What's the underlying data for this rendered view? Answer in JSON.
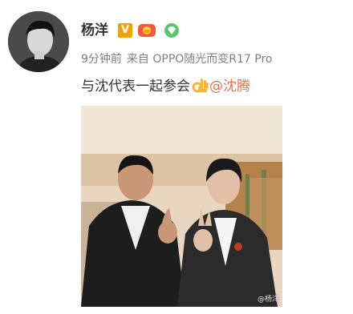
{
  "post": {
    "username": "杨洋",
    "badges": {
      "verified": "V",
      "verified_color": "#f2a300"
    },
    "meta": {
      "time": "9分钟前",
      "source": "来自 OPPO随光而变R17 Pro"
    },
    "content": {
      "text": "与沈代表一起参会",
      "emoji": "ok-hand-emoji",
      "mention": "@沈腾"
    },
    "photo": {
      "watermark": "@杨洋"
    }
  },
  "colors": {
    "mention": "#eb7350",
    "meta": "#808080"
  }
}
